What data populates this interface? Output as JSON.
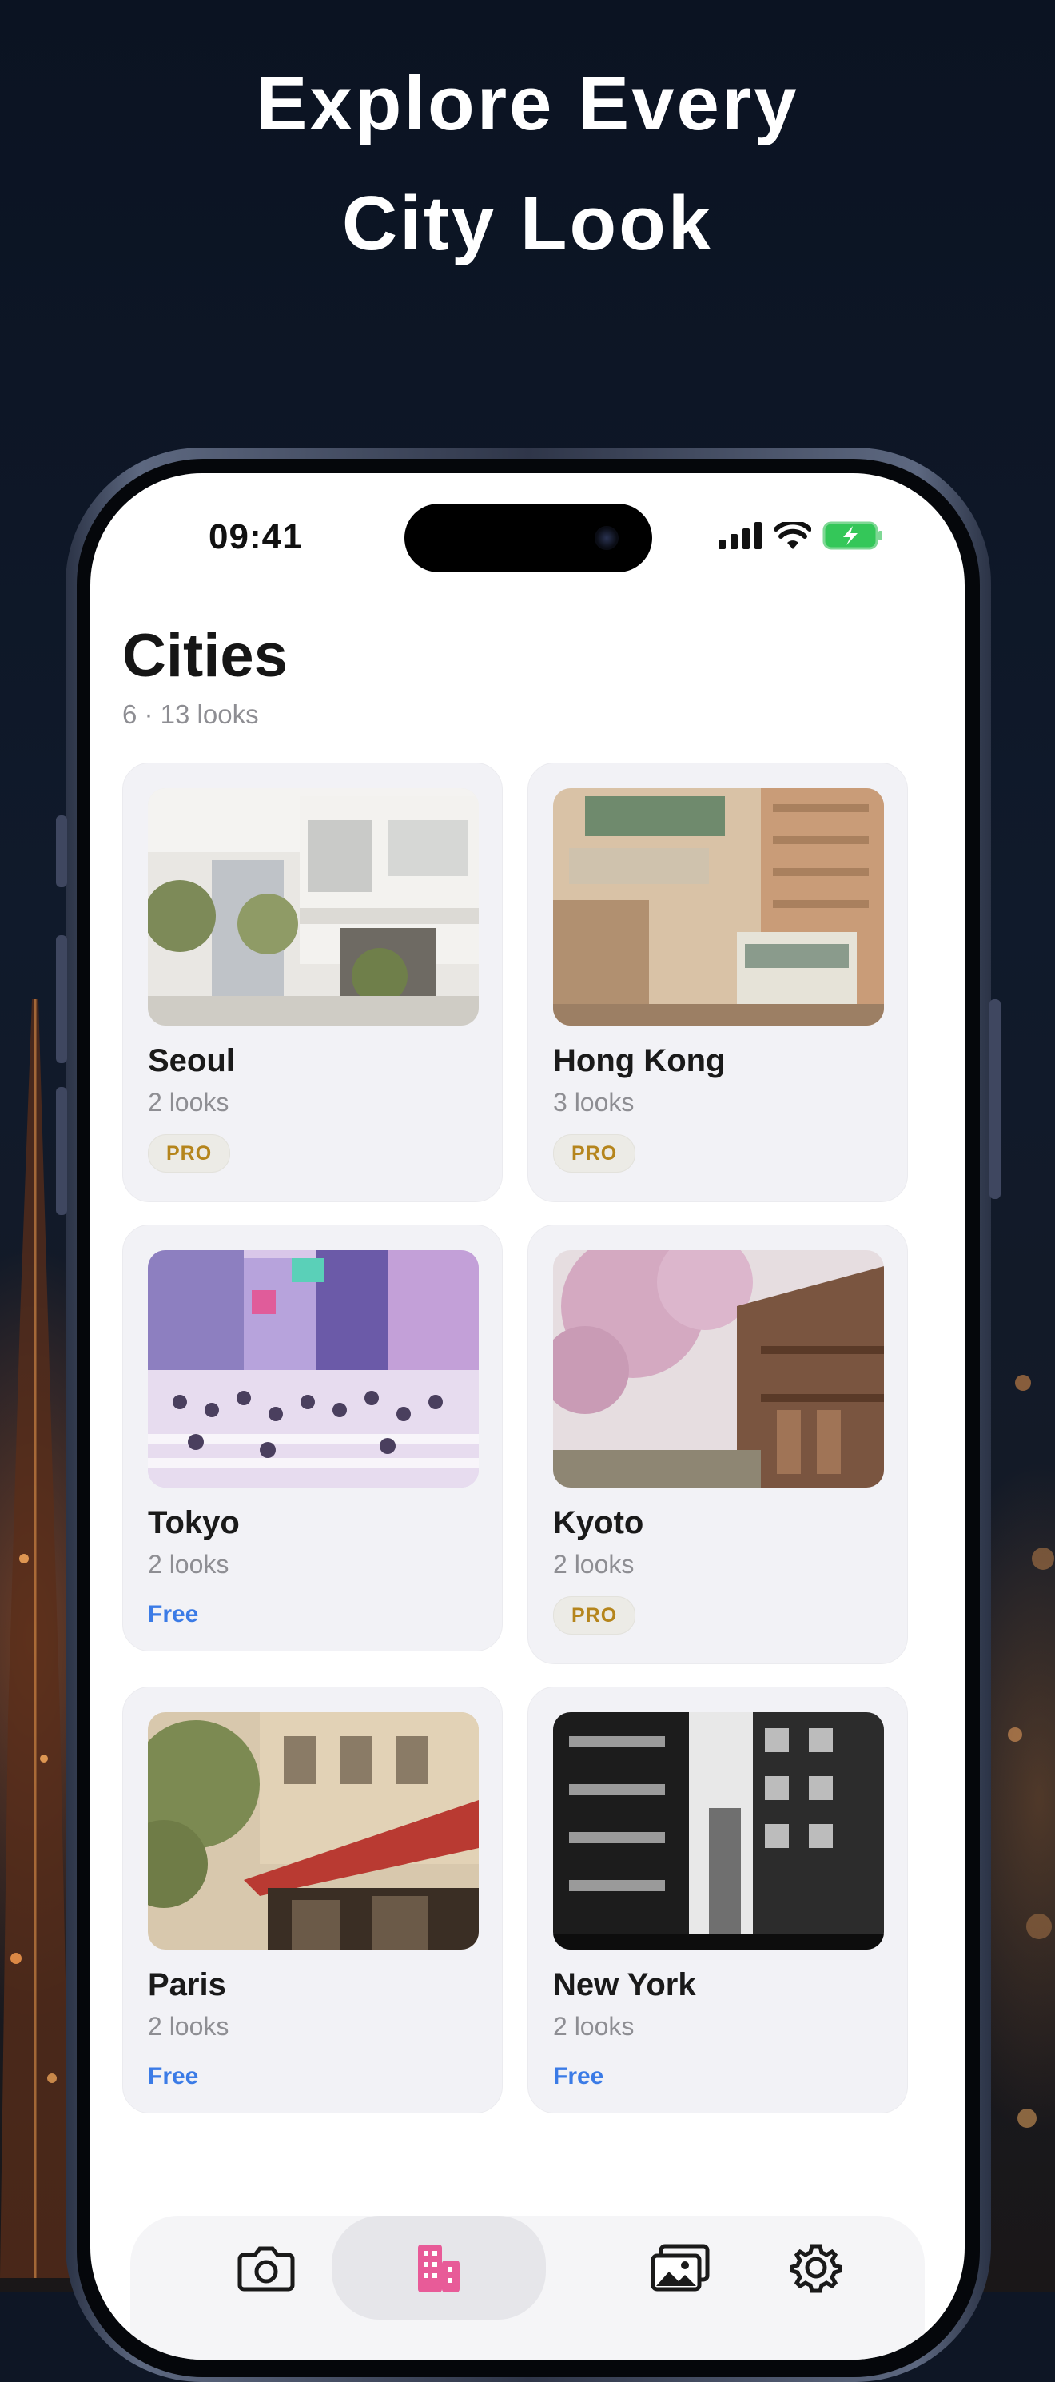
{
  "headline": {
    "line1": "Explore Every",
    "line2": "City Look"
  },
  "status_bar": {
    "time": "09:41"
  },
  "page": {
    "title": "Cities",
    "subtitle": "6 · 13 looks"
  },
  "cities": [
    {
      "name": "Seoul",
      "count": "2 looks",
      "tier": "PRO"
    },
    {
      "name": "Hong Kong",
      "count": "3 looks",
      "tier": "PRO"
    },
    {
      "name": "Tokyo",
      "count": "2 looks",
      "tier": "Free"
    },
    {
      "name": "Kyoto",
      "count": "2 looks",
      "tier": "PRO"
    },
    {
      "name": "Paris",
      "count": "2 looks",
      "tier": "Free"
    },
    {
      "name": "New York",
      "count": "2 looks",
      "tier": "Free"
    }
  ],
  "tab_bar": {
    "tabs": [
      {
        "icon": "camera-icon"
      },
      {
        "icon": "building-icon",
        "active": true
      },
      {
        "icon": "photo-gallery-icon"
      },
      {
        "icon": "gear-icon"
      }
    ],
    "accent": "#e85b98"
  },
  "colors": {
    "pro": "#b5851c",
    "free": "#3b7be6",
    "battery": "#34c759"
  }
}
